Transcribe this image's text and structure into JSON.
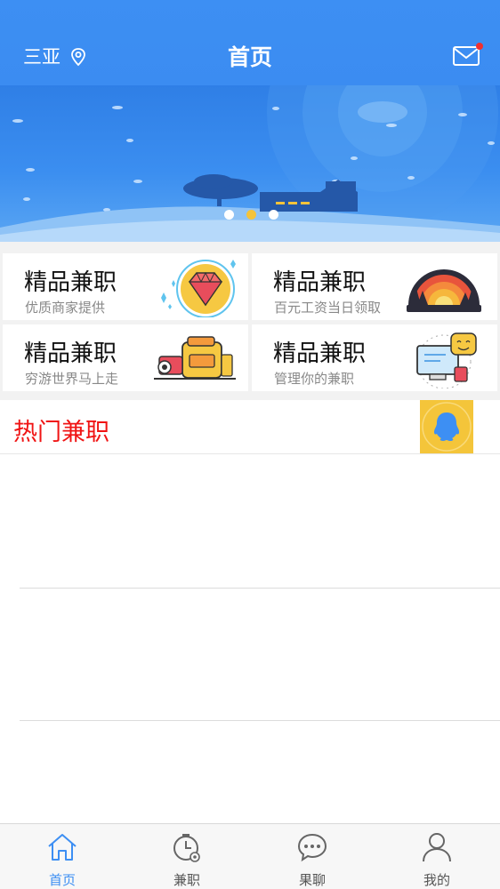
{
  "header": {
    "city": "三亚",
    "title": "首页",
    "pin_icon": "location-pin-icon",
    "mail_icon": "mail-icon",
    "bg_color": "#3d8ff3",
    "notification_dot_color": "#f03030"
  },
  "banner": {
    "slide_count": 3,
    "active_slide": 2,
    "active_dot_color": "#f4c33a"
  },
  "cards": [
    {
      "title": "精品兼职",
      "subtitle": "优质商家提供",
      "icon": "diamond-icon"
    },
    {
      "title": "精品兼职",
      "subtitle": "百元工资当日领取",
      "icon": "sunset-icon"
    },
    {
      "title": "精品兼职",
      "subtitle": "穷游世界马上走",
      "icon": "travel-gear-icon"
    },
    {
      "title": "精品兼职",
      "subtitle": "管理你的兼职",
      "icon": "computer-chat-icon"
    }
  ],
  "hot": {
    "title": "热门兼职",
    "title_color": "#f01414",
    "qq_icon": "qq-icon"
  },
  "tabbar": {
    "active_color": "#3d8ff3",
    "items": [
      {
        "label": "首页",
        "icon": "home-icon"
      },
      {
        "label": "兼职",
        "icon": "clock-icon"
      },
      {
        "label": "果聊",
        "icon": "chat-bubble-icon"
      },
      {
        "label": "我的",
        "icon": "user-icon"
      }
    ]
  }
}
